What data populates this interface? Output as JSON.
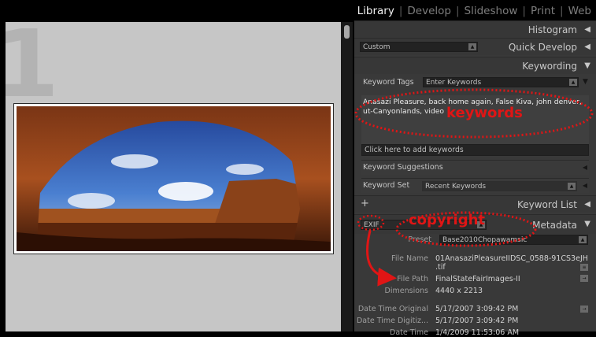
{
  "grid": {
    "cell_number": "1"
  },
  "modules": {
    "items": [
      {
        "label": "Library",
        "active": true
      },
      {
        "label": "Develop",
        "active": false
      },
      {
        "label": "Slideshow",
        "active": false
      },
      {
        "label": "Print",
        "active": false
      },
      {
        "label": "Web",
        "active": false
      }
    ]
  },
  "panels": {
    "histogram": "Histogram",
    "quick_develop": "Quick Develop",
    "quick_develop_preset": "Custom",
    "keywording": "Keywording",
    "keyword_tags_label": "Keyword Tags",
    "keyword_tags_value": "Enter Keywords",
    "keywords_text": "Anasazi Pleasure, back home again, False Kiva, john denver, ut-Canyonlands, video",
    "add_keywords": "Click here to add keywords",
    "keyword_suggestions": "Keyword Suggestions",
    "keyword_set_label": "Keyword Set",
    "keyword_set_value": "Recent Keywords",
    "keyword_list": "Keyword List",
    "plus": "+",
    "metadata": "Metadata",
    "exif": "EXIF",
    "preset_label": "Preset",
    "preset_value": "Base2010Chopawamsic"
  },
  "metadata_fields": [
    {
      "label": "File Name",
      "value": "01AnasaziPleasureIIDSC_0588-91CS3eJH",
      "value2": ".tif"
    },
    {
      "label": "File Path",
      "value": "FinalStateFairImages-II"
    },
    {
      "label": "Dimensions",
      "value": "4440 x 2213"
    },
    {
      "label": "Date Time Original",
      "value": "5/17/2007 3:09:42 PM"
    },
    {
      "label": "Date Time Digitiz...",
      "value": "5/17/2007 3:09:42 PM"
    },
    {
      "label": "Date Time",
      "value": "1/4/2009 11:53:06 AM"
    }
  ],
  "annotations": {
    "keywords": "keywords",
    "copyright": "copyright"
  },
  "colors": {
    "annotation": "#e01515",
    "panel_bg": "#393939",
    "grid_bg": "#c6c6c6",
    "active_module": "#f0f0f0"
  }
}
